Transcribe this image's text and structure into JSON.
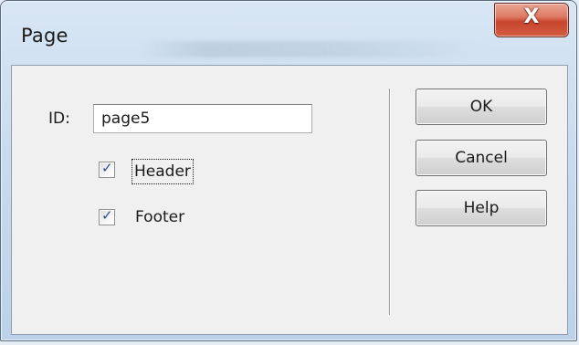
{
  "window": {
    "title": "Page",
    "close_glyph": "X"
  },
  "form": {
    "id_label": "ID:",
    "id_value": "page5",
    "header": {
      "label": "Header",
      "checked": true
    },
    "footer": {
      "label": "Footer",
      "checked": true
    },
    "check_glyph": "✓"
  },
  "buttons": {
    "ok": "OK",
    "cancel": "Cancel",
    "help": "Help"
  },
  "icons": {
    "close": "close-icon",
    "checkmark": "checkmark-icon"
  }
}
